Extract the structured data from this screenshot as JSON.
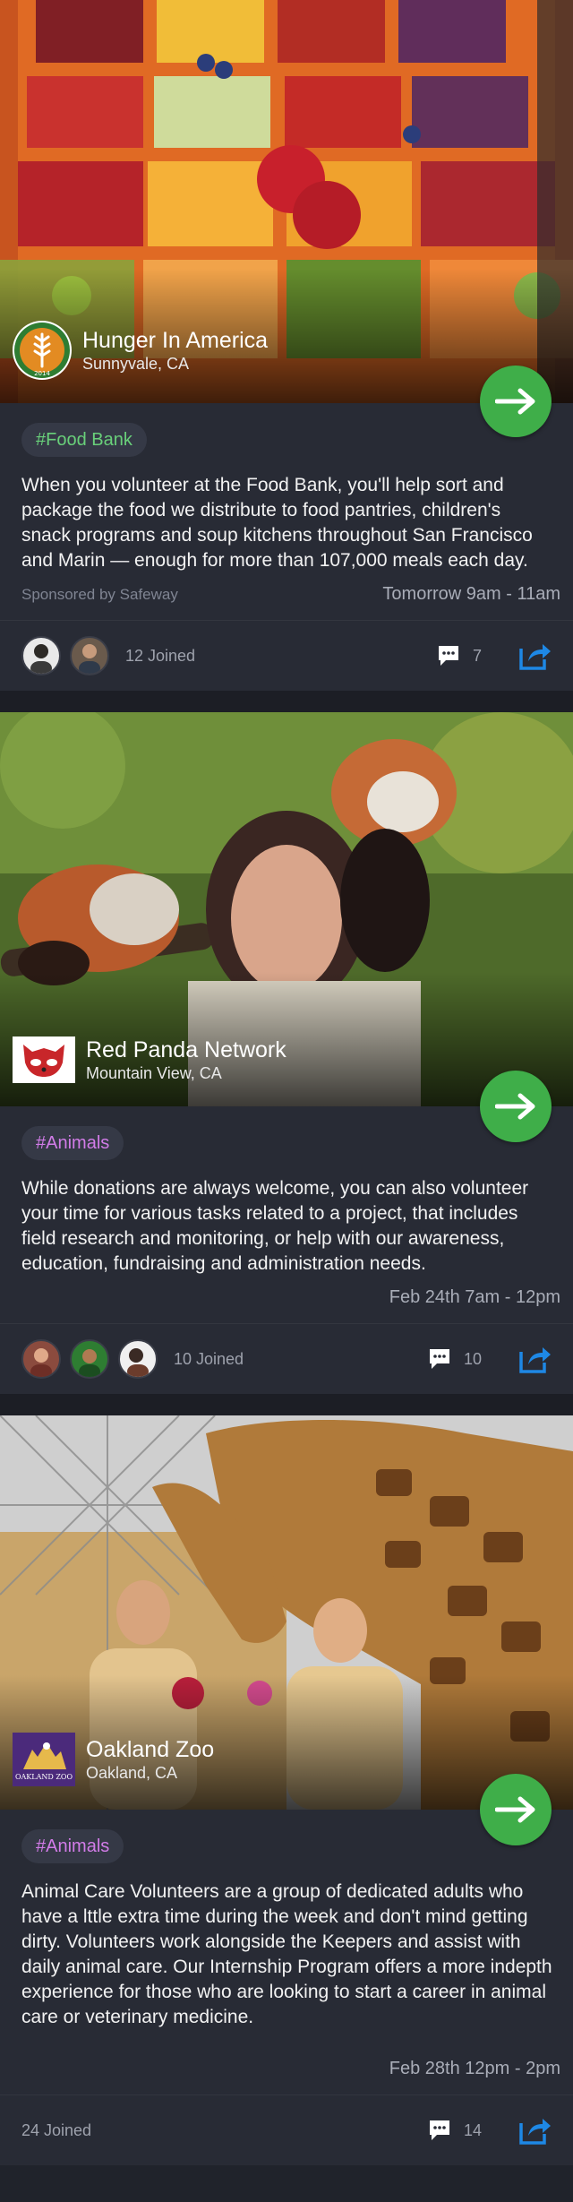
{
  "colors": {
    "go_button": "#3fae49",
    "share_icon": "#1e88e5",
    "tag_food": "#69d07a",
    "tag_animals": "#d27ce8"
  },
  "cards": [
    {
      "org_name": "Hunger In America",
      "org_location": "Sunnyvale, CA",
      "logo_icon": "hunger-in-america-2014-logo",
      "logo_text_top": "HUNGER IN AMERICA",
      "logo_text_bottom": "2014",
      "tag": "#Food Bank",
      "description": "When you volunteer at the Food Bank, you'll help sort and package the food we distribute to food pantries, children's snack programs and soup kitchens throughout San Francisco and Marin — enough for more than 107,000 meals each day.",
      "sponsor": "Sponsored by Safeway",
      "when": "Tomorrow 9am - 11am",
      "joined": "12 Joined",
      "comments": "7"
    },
    {
      "org_name": "Red Panda Network",
      "org_location": "Mountain View, CA",
      "logo_icon": "red-panda-logo",
      "tag": "#Animals",
      "description": "While donations are always welcome, you can also volunteer your time for various tasks related to a project, that includes field research and monitoring, or help with our awareness, education, fundraising and administration needs.",
      "when": "Feb 24th 7am - 12pm",
      "joined": "10 Joined",
      "comments": "10"
    },
    {
      "org_name": "Oakland Zoo",
      "org_location": "Oakland, CA",
      "logo_icon": "oakland-zoo-logo",
      "logo_text": "OAKLAND ZOO",
      "tag": "#Animals",
      "description": "Animal Care Volunteers are a group of dedicated adults who have a lttle extra time during the week and don't mind getting dirty. Volunteers work alongside the Keepers and assist with daily animal care. Our Internship Program offers a more indepth experience for those who are looking to start a career in animal care or veterinary medicine.",
      "when": "Feb 28th 12pm - 2pm",
      "joined": "24 Joined",
      "comments": "14"
    }
  ]
}
